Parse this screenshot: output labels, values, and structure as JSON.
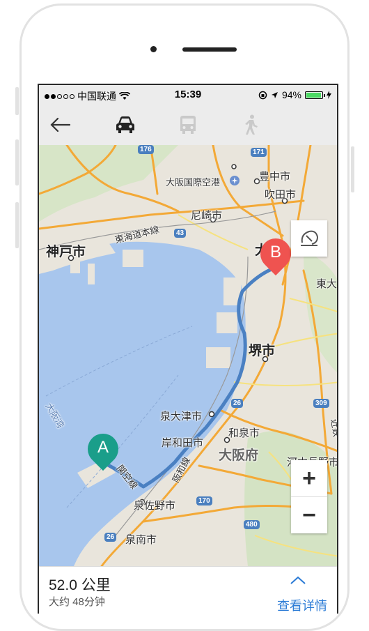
{
  "status_bar": {
    "carrier": "中国联通",
    "time": "15:39",
    "battery": "94%",
    "battery_level": 0.94
  },
  "toolbar": {
    "back_icon": "back-arrow-icon",
    "modes": [
      {
        "name": "car",
        "icon": "car-icon",
        "active": true
      },
      {
        "name": "bus",
        "icon": "bus-icon",
        "active": false
      },
      {
        "name": "walk",
        "icon": "walk-icon",
        "active": false
      }
    ]
  },
  "map": {
    "labels": {
      "kobe": "神戸市",
      "amagasaki": "尼崎市",
      "toyonaka": "豊中市",
      "suita": "吹田市",
      "airport": "大阪国際空港",
      "tokaido": "東海道本線",
      "osaka_partial": "大",
      "higashi_partial": "東大",
      "sakai": "堺市",
      "izumiotsu": "泉大津市",
      "kishiwada": "岸和田市",
      "izumi": "和泉市",
      "osakafu": "大阪府",
      "hanwa": "阪和線",
      "kanku": "関空線",
      "izumisano": "泉佐野市",
      "sennan": "泉南市",
      "kawachi": "河内長野市",
      "bay": "大阪湾",
      "kintetsu": "近鉄"
    },
    "shields": [
      "176",
      "171",
      "43",
      "26",
      "309",
      "170",
      "480",
      "26"
    ],
    "marker_a": "A",
    "marker_b": "B",
    "accent_route": "#4a80c2",
    "marker_a_color": "#1a9e8a",
    "marker_b_color": "#ef5350",
    "zoom_in": "+",
    "zoom_out": "−"
  },
  "route": {
    "distance": "52.0 公里",
    "duration": "大约 48分钟",
    "details_label": "查看详情"
  }
}
